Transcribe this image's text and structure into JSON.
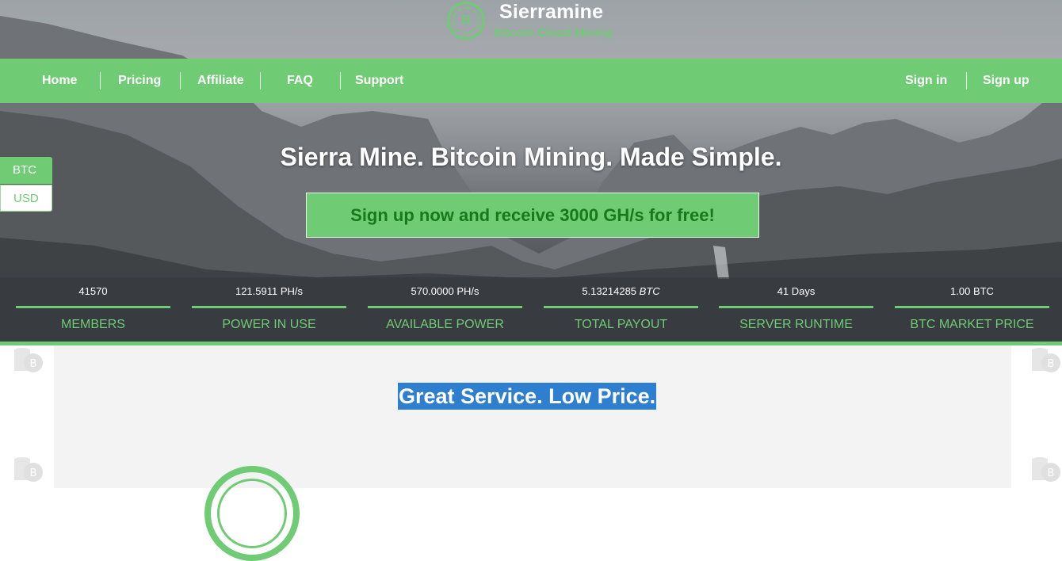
{
  "brand": {
    "logo_icon": "bitcoin-coin-icon",
    "logo_glyph": "B",
    "name": "Sierramine",
    "tagline": "Bitcoin Cloud Mining"
  },
  "nav": {
    "left": [
      "Home",
      "Pricing",
      "Affiliate",
      "FAQ",
      "Support"
    ],
    "right": [
      "Sign in",
      "Sign up"
    ]
  },
  "currency_toggle": {
    "options": [
      "BTC",
      "USD"
    ],
    "selected": "BTC"
  },
  "hero": {
    "headline": "Sierra Mine. Bitcoin Mining. Made Simple.",
    "cta": "Sign up now and receive 3000 GH/s for free!"
  },
  "stats": [
    {
      "value": "41570",
      "unit": "",
      "label": "MEMBERS"
    },
    {
      "value": "121.5911 PH/s",
      "unit": "",
      "label": "POWER IN USE"
    },
    {
      "value": "570.0000 PH/s",
      "unit": "",
      "label": "AVAILABLE POWER"
    },
    {
      "value": "5.13214285",
      "unit": "BTC",
      "label": "TOTAL PAYOUT"
    },
    {
      "value": "41 Days",
      "unit": "",
      "label": "SERVER RUNTIME"
    },
    {
      "value": "1.00 BTC",
      "unit": "",
      "label": "BTC MARKET PRICE"
    }
  ],
  "section": {
    "title": "Great Service. Low Price.",
    "decor_icon": "coin-stack-icon"
  },
  "colors": {
    "accent": "#6fcb74",
    "cta_text": "#167a1c",
    "selection": "#2f7fd1",
    "panel": "#f3f3f3"
  }
}
